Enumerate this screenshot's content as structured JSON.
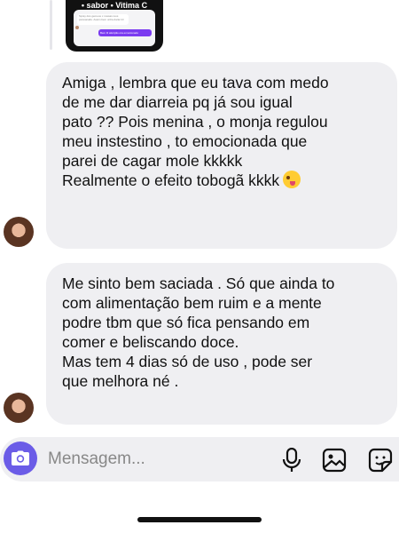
{
  "preview": {
    "top_text": "• sabor • Vitima C",
    "bubble_in_text": "Spray dos gemeos x nossas reus psicoanalis. Assim bem unha daria 10",
    "bubble_out_text": "Bem R aferição ora emocionado"
  },
  "messages": [
    {
      "lines": [
        "Amiga , lembra que eu tava com medo",
        "de me dar diarreia pq já sou igual",
        "pato ?? Pois menina , o monja regulou",
        "meu instestino , to emocionada que",
        "parei de cagar mole kkkkk"
      ],
      "last_line": "Realmente o efeito tobogã kkkk",
      "emoji": "zany-face"
    },
    {
      "lines": [
        "Me sinto bem saciada . Só que ainda to",
        "com alimentação bem ruim e a mente",
        "podre tbm que só fica pensando em",
        "comer e beliscando doce.",
        "Mas tem 4 dias só de uso , pode ser",
        "que melhora né ."
      ]
    }
  ],
  "composer": {
    "placeholder": "Mensagem...",
    "accent_color": "#6b5ce7",
    "icons": [
      "camera-icon",
      "microphone-icon",
      "gallery-icon",
      "sticker-icon"
    ]
  }
}
